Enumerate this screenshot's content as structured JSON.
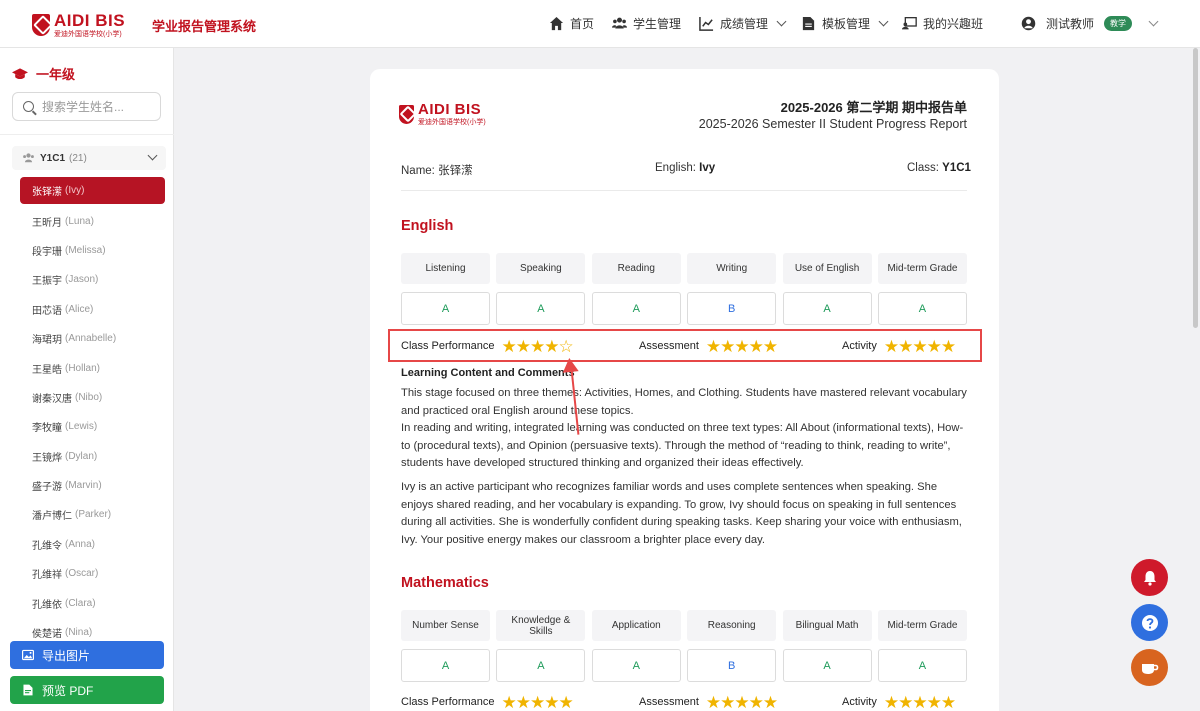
{
  "nav": {
    "logo_main": "AIDI BIS",
    "logo_sub": "爱迪外国语学校(小学)",
    "system_title": "学业报告管理系统",
    "home": "首页",
    "students": "学生管理",
    "grades": "成绩管理",
    "templates": "模板管理",
    "interests": "我的兴趣班",
    "user": "测试教师",
    "role_badge": "教学"
  },
  "sidebar": {
    "grade": "一年级",
    "search_placeholder": "搜索学生姓名...",
    "class_name": "Y1C1",
    "class_count": "(21)",
    "students": [
      {
        "cn": "张铎潆",
        "en": "(Ivy)",
        "active": true
      },
      {
        "cn": "王昕月",
        "en": "(Luna)"
      },
      {
        "cn": "段宇珊",
        "en": "(Melissa)"
      },
      {
        "cn": "王振宇",
        "en": "(Jason)"
      },
      {
        "cn": "田芯语",
        "en": "(Alice)"
      },
      {
        "cn": "海珺玥",
        "en": "(Annabelle)"
      },
      {
        "cn": "王星皓",
        "en": "(Hollan)"
      },
      {
        "cn": "谢秦汉唐",
        "en": "(Nibo)"
      },
      {
        "cn": "李牧瞳",
        "en": "(Lewis)"
      },
      {
        "cn": "王镜烨",
        "en": "(Dylan)"
      },
      {
        "cn": "盛子游",
        "en": "(Marvin)"
      },
      {
        "cn": "潘卢博仁",
        "en": "(Parker)"
      },
      {
        "cn": "孔维令",
        "en": "(Anna)"
      },
      {
        "cn": "孔维祥",
        "en": "(Oscar)"
      },
      {
        "cn": "孔维依",
        "en": "(Clara)"
      },
      {
        "cn": "侯楚诺",
        "en": "(Nina)"
      }
    ],
    "export_image": "导出图片",
    "preview_pdf": "预览 PDF"
  },
  "report": {
    "logo_main": "AIDI BIS",
    "logo_sub": "爱迪外国语学校(小学)",
    "title_cn": "2025-2026 第二学期 期中报告单",
    "title_en": "2025-2026 Semester II Student Progress Report",
    "name_label": "Name:",
    "name_value": "张铎潆",
    "english_label": "English:",
    "english_value": "Ivy",
    "class_label": "Class:",
    "class_value": "Y1C1",
    "english": {
      "title": "English",
      "headers": [
        "Listening",
        "Speaking",
        "Reading",
        "Writing",
        "Use of English",
        "Mid-term Grade"
      ],
      "grades": [
        "A",
        "A",
        "A",
        "B",
        "A",
        "A"
      ],
      "class_performance_label": "Class Performance",
      "class_performance_stars": 4,
      "assessment_label": "Assessment",
      "assessment_stars": 5,
      "activity_label": "Activity",
      "activity_stars": 5,
      "comments_title": "Learning Content and Comments",
      "para1": "This stage focused on three themes: Activities, Homes, and Clothing. Students have mastered relevant vocabulary and practiced oral English around these topics.",
      "para2": "In reading and writing, integrated learning was conducted on three text types: All About (informational texts), How-to (procedural texts), and Opinion (persuasive texts). Through the method of “reading to think, reading to write”, students have developed structured thinking and organized their ideas effectively.",
      "para3": "Ivy is an active participant who recognizes familiar words and uses complete sentences when speaking. She enjoys shared reading, and her vocabulary is expanding. To grow, Ivy should focus on speaking in full sentences during all activities. She is wonderfully confident during speaking tasks. Keep sharing your voice with enthusiasm, Ivy. Your positive energy makes our classroom a brighter place every day."
    },
    "math": {
      "title": "Mathematics",
      "headers": [
        "Number Sense",
        "Knowledge & Skills",
        "Application",
        "Reasoning",
        "Bilingual Math",
        "Mid-term Grade"
      ],
      "grades": [
        "A",
        "A",
        "A",
        "B",
        "A",
        "A"
      ],
      "class_performance_label": "Class Performance",
      "class_performance_stars": 5,
      "assessment_label": "Assessment",
      "assessment_stars": 5,
      "activity_label": "Activity",
      "activity_stars": 5
    }
  },
  "colors": {
    "brand_red": "#c1121f",
    "grade_a": "#1e9b5a",
    "grade_b": "#2f6fdf",
    "star": "#f0b400",
    "highlight": "#e64747"
  }
}
